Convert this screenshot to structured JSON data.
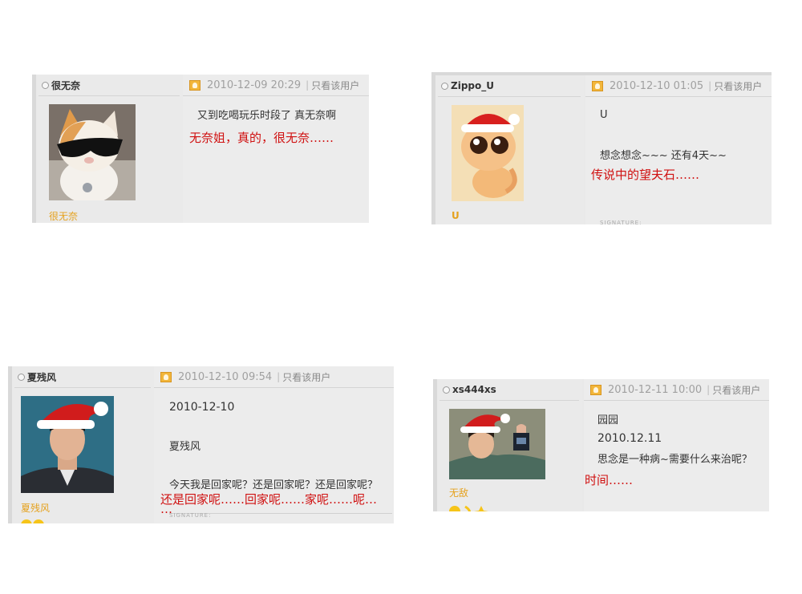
{
  "posts": [
    {
      "author": "很无奈",
      "datetime": "2010-12-09 20:29",
      "only_user": "只看该用户",
      "username_label": "很无奈",
      "lines": [
        "又到吃喝玩乐时段了 真无奈啊"
      ],
      "annotation": "无奈姐，真的，很无奈……"
    },
    {
      "author": "Zippo_U",
      "datetime": "2010-12-10 01:05",
      "only_user": "只看该用户",
      "username_label": "U",
      "lines": [
        "U",
        "想念想念~~~ 还有4天~~"
      ],
      "annotation": "传说中的望夫石……",
      "signature": "SIGNATURE:"
    },
    {
      "author": "夏残风",
      "datetime": "2010-12-10 09:54",
      "only_user": "只看该用户",
      "username_label": "夏残风",
      "lines": [
        "2010-12-10",
        "夏残风",
        "今天我是回家呢？还是回家呢？还是回家呢？"
      ],
      "annotation_lines": [
        "还是回家呢……回家呢……家呢……呢…",
        "…"
      ],
      "signature": "SIGNATURE:"
    },
    {
      "author": "xs444xs",
      "datetime": "2010-12-11 10:00",
      "only_user": "只看该用户",
      "username_label": "无敌",
      "lines": [
        "园园",
        "2010.12.11",
        "思念是一种病~需要什么来治呢？"
      ],
      "annotation": "时间……"
    }
  ],
  "colors": {
    "annotation": "#d01010",
    "username": "#e5a11d",
    "panel": "#e9e9e9"
  }
}
